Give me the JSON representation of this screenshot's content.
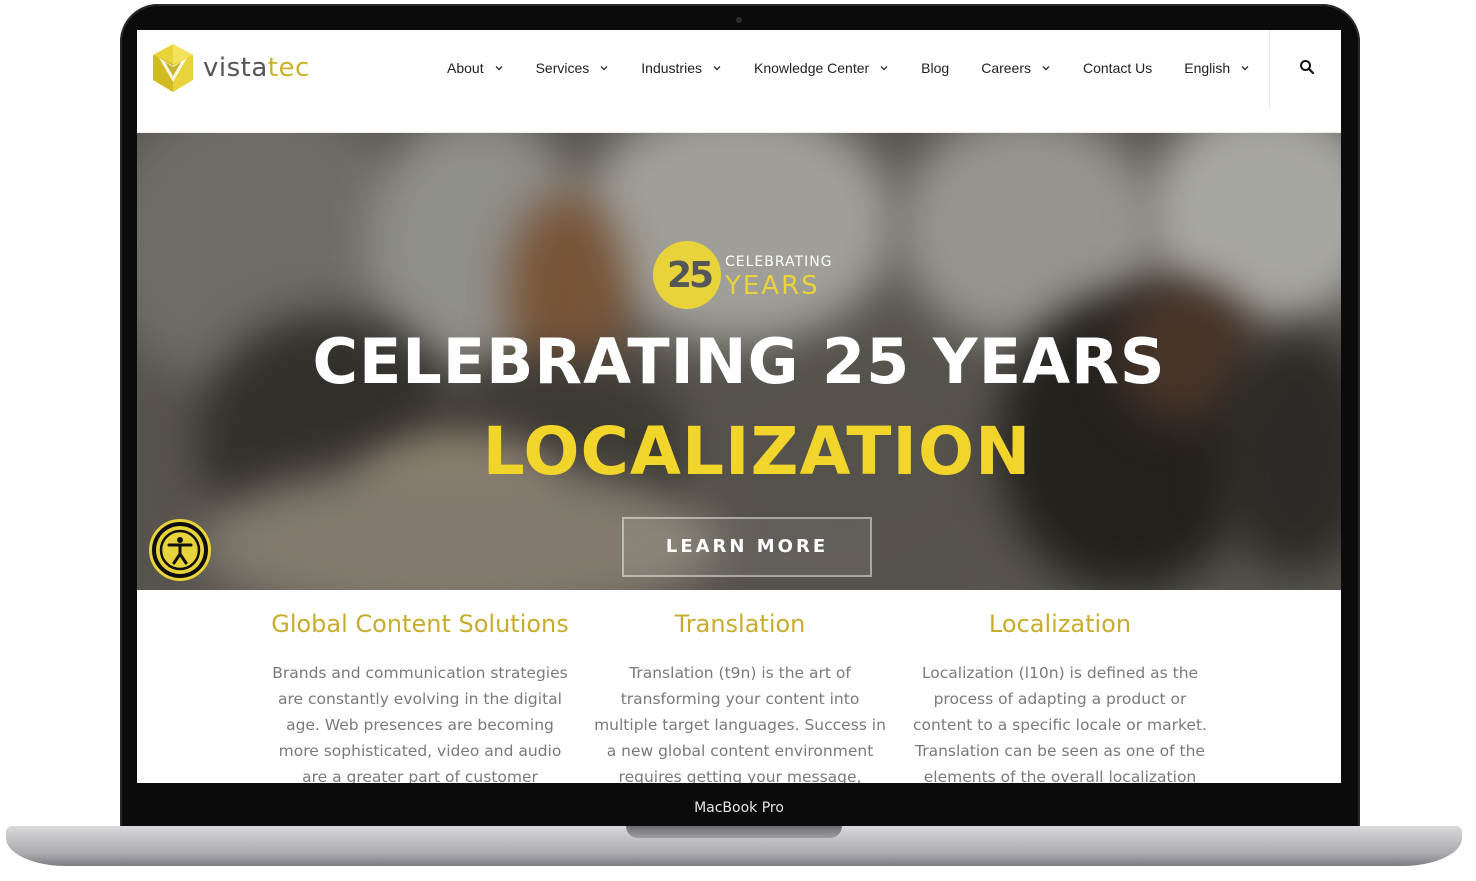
{
  "device_label": "MacBook Pro",
  "brand": {
    "logo_text_main": "vista",
    "logo_text_accent": "tec",
    "accent_color": "#c9b22b",
    "highlight_color": "#f2d52a"
  },
  "nav": {
    "items": [
      {
        "label": "About",
        "dropdown": true
      },
      {
        "label": "Services",
        "dropdown": true
      },
      {
        "label": "Industries",
        "dropdown": true
      },
      {
        "label": "Knowledge Center",
        "dropdown": true
      },
      {
        "label": "Blog",
        "dropdown": false
      },
      {
        "label": "Careers",
        "dropdown": true
      },
      {
        "label": "Contact Us",
        "dropdown": false
      },
      {
        "label": "English",
        "dropdown": true
      }
    ],
    "search_icon": "search-icon"
  },
  "hero": {
    "badge_number": "25",
    "badge_top": "CELEBRATING",
    "badge_bottom": "YEARS",
    "title_line1": "CELEBRATING 25 YEARS",
    "title_line2": "LOCALIZATION",
    "cta_label": "LEARN MORE",
    "accessibility_icon": "accessibility-icon"
  },
  "columns": [
    {
      "title": "Global Content Solutions",
      "text": "Brands and communication strategies are constantly evolving in the digital age. Web presences are becoming more sophisticated, video and audio are a greater part of customer engagement,"
    },
    {
      "title": "Translation",
      "text": "Translation (t9n) is the art of transforming your content into multiple target languages. Success in a new global content environment requires getting your message, product or"
    },
    {
      "title": "Localization",
      "text": "Localization (l10n) is defined as the process of adapting a product or content to a specific locale or market. Translation can be seen as one of the elements of the overall localization"
    }
  ]
}
